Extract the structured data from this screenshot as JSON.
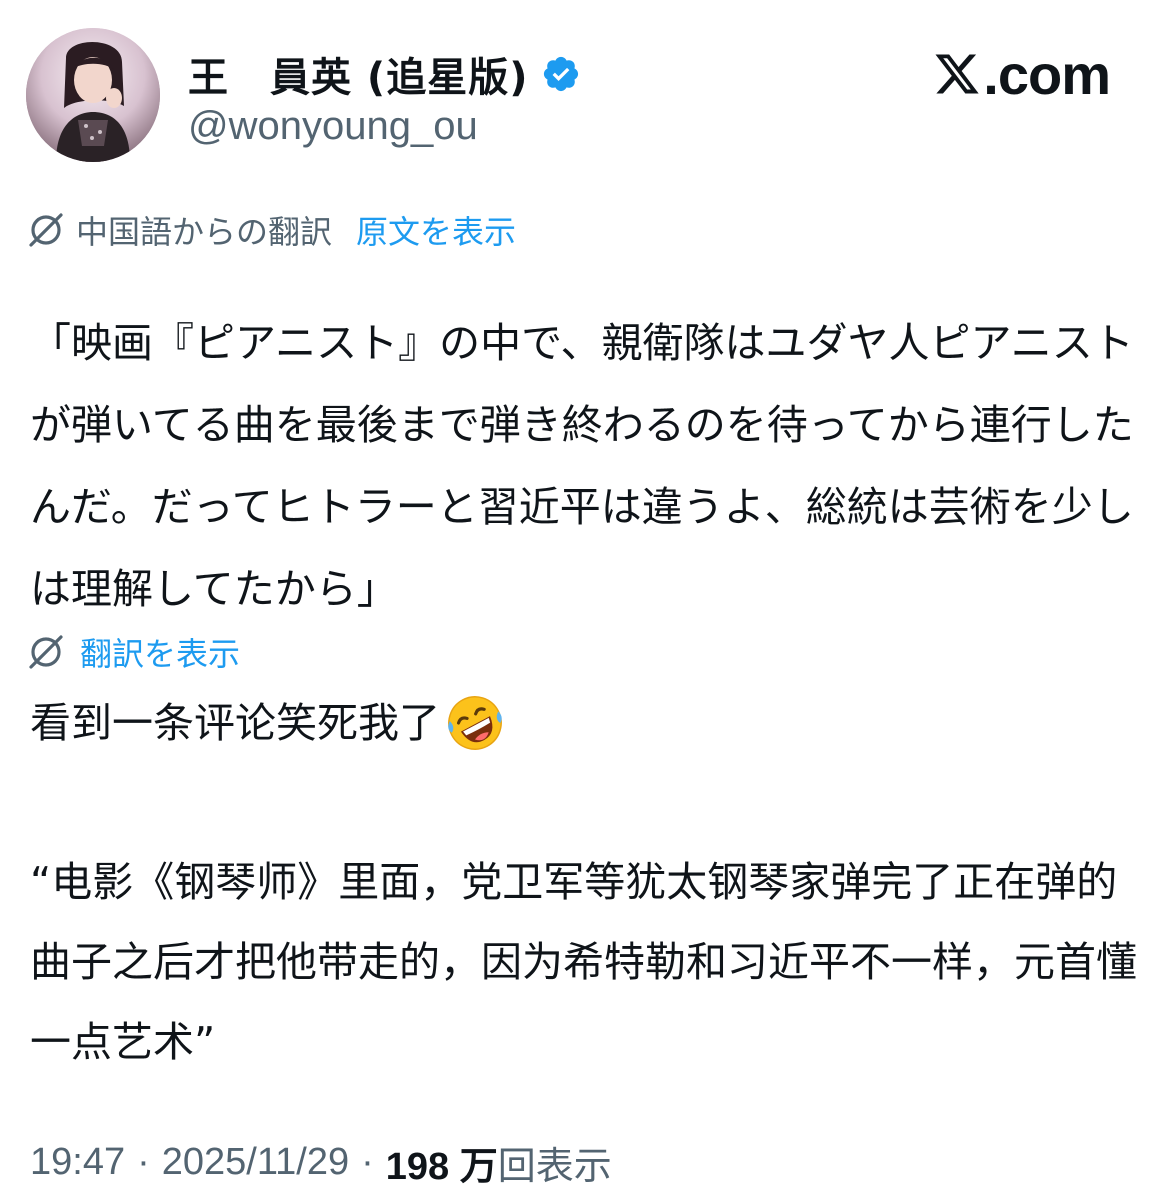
{
  "user": {
    "display_name": "王　員英 (追星版)",
    "handle": "@wonyoung_ou",
    "verified": true,
    "verified_color": "#1d9bf0",
    "avatar_icon": "profile-photo"
  },
  "site_logo": {
    "text": ".com",
    "icon": "x-logo"
  },
  "translation_banner": {
    "source_label": "中国語からの翻訳",
    "show_original_link": "原文を表示",
    "icon": "globe-slash-icon"
  },
  "translated_text": "「映画『ピアニスト』の中で、親衛隊はユダヤ人ピアニストが弾いてる曲を最後まで弾き終わるのを待ってから連行したんだ。だってヒトラーと習近平は違うよ、総統は芸術を少しは理解してたから」",
  "show_translation": {
    "label": "翻訳を表示",
    "icon": "globe-slash-icon"
  },
  "original_text": {
    "line1": "看到一条评论笑死我了",
    "emoji": "rolling-on-the-floor-laughing",
    "quote": "“电影《钢琴师》里面，党卫军等犹太钢琴家弹完了正在弹的曲子之后才把他带走的，因为希特勒和习近平不一样，元首懂一点艺术”"
  },
  "meta": {
    "time": "19:47",
    "separator": "·",
    "date": "2025/11/29",
    "views_count": "198 万",
    "views_label": "回表示"
  },
  "colors": {
    "text": "#0f1419",
    "muted": "#536471",
    "accent": "#1d9bf0"
  }
}
